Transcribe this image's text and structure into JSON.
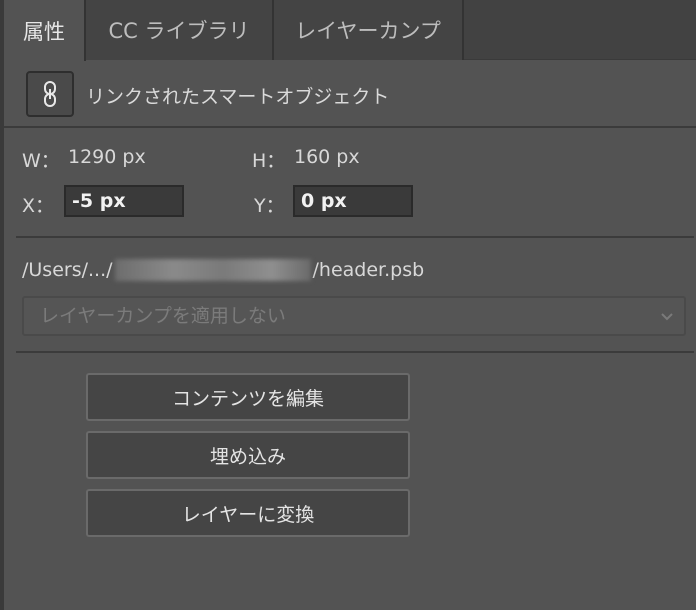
{
  "tabs": [
    {
      "label": "属性",
      "active": true
    },
    {
      "label": "CC ライブラリ",
      "active": false
    },
    {
      "label": "レイヤーカンプ",
      "active": false
    }
  ],
  "smart_object": {
    "icon": "link-icon",
    "label": "リンクされたスマートオブジェクト"
  },
  "transform": {
    "w_label": "W：",
    "w_value": "1290 px",
    "h_label": "H：",
    "h_value": "160 px",
    "x_label": "X：",
    "x_value": "-5 px",
    "y_label": "Y：",
    "y_value": "0 px"
  },
  "file": {
    "path_prefix": "/Users/.../",
    "path_suffix": "/header.psb"
  },
  "layer_comp": {
    "placeholder": "レイヤーカンプを適用しない"
  },
  "buttons": {
    "edit_contents": "コンテンツを編集",
    "embed": "埋め込み",
    "convert_to_layers": "レイヤーに変換"
  },
  "colors": {
    "panel_bg": "#535353",
    "tab_bg": "#424242",
    "field_bg": "#3a3a3a",
    "button_bg": "#454545"
  }
}
